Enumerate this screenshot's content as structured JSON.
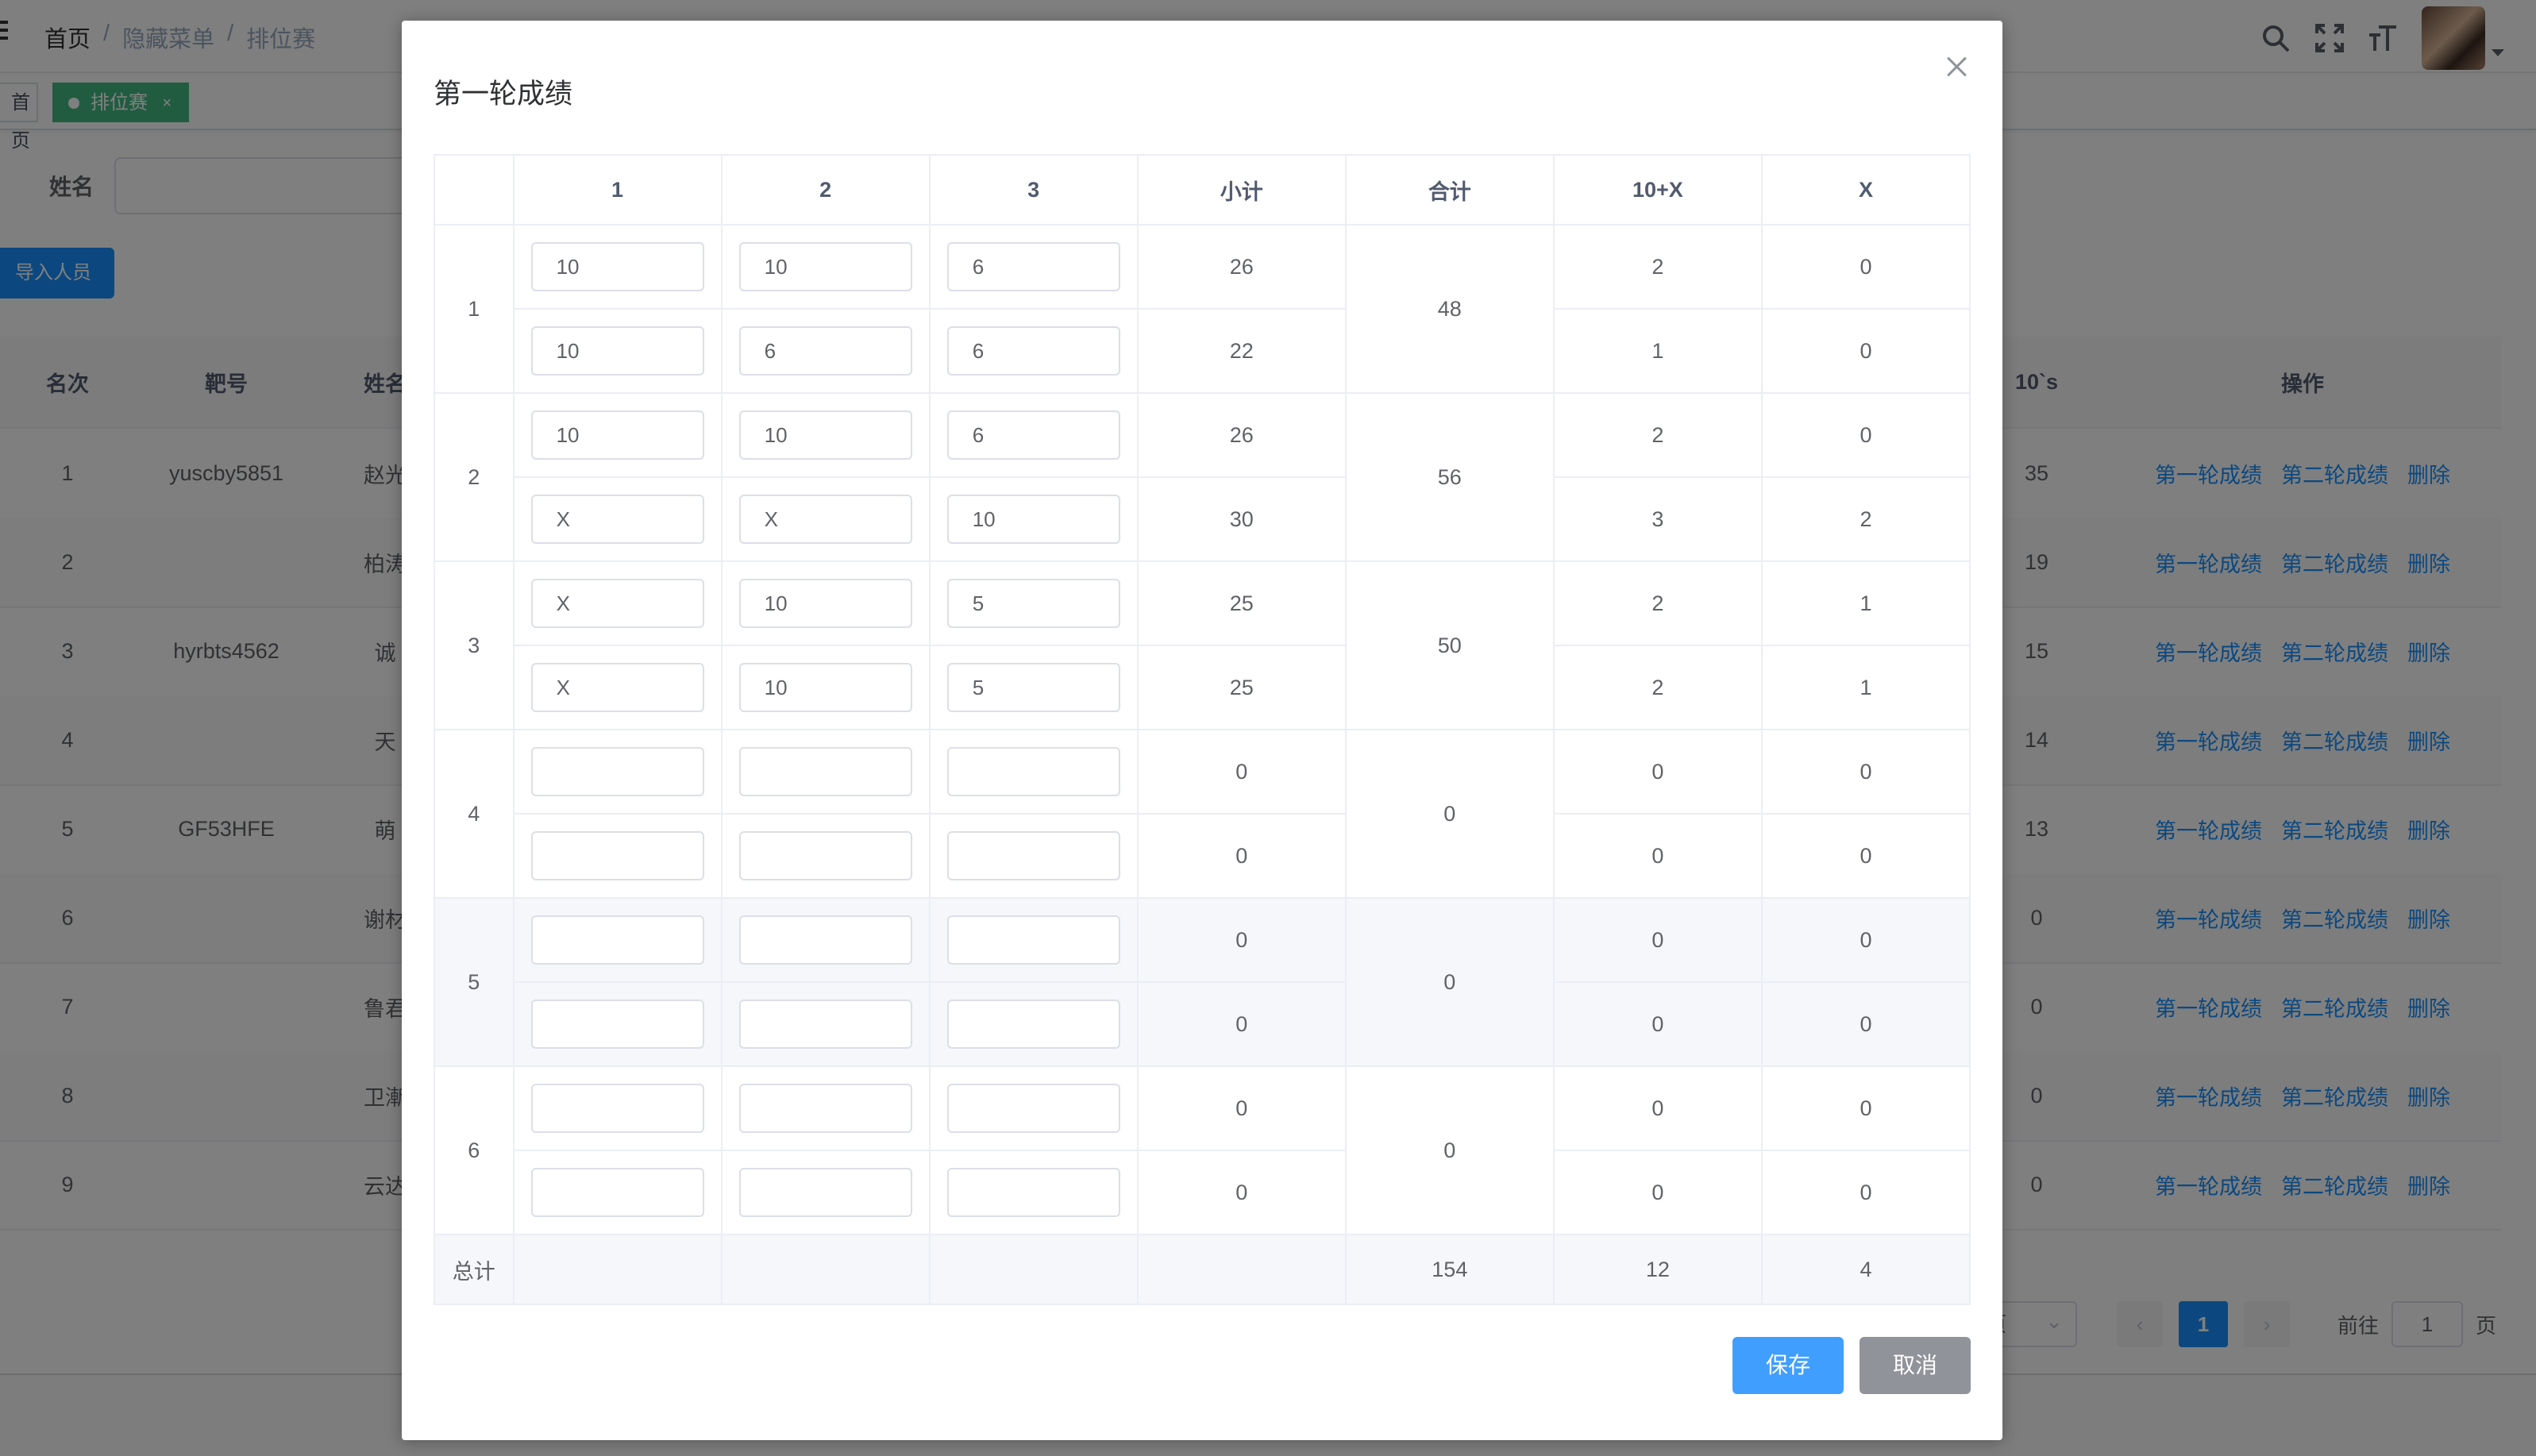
{
  "breadcrumb": [
    "首页",
    "隐藏菜单",
    "排位赛"
  ],
  "breadcrumb_separator": "/",
  "tags": [
    {
      "label": "首页"
    },
    {
      "label": "排位赛",
      "close": "×"
    }
  ],
  "search": {
    "label": "姓名",
    "value": ""
  },
  "import_button": "导入人员",
  "bg_table": {
    "headers": {
      "rank": "名次",
      "target": "靶号",
      "name": "姓名",
      "tens": "10`s",
      "ops": "操作"
    },
    "ops_links": [
      "第一轮成绩",
      "第二轮成绩",
      "删除"
    ],
    "rows": [
      {
        "rank": "1",
        "target": "yuscby5851",
        "name": "赵光",
        "tens": "35"
      },
      {
        "rank": "2",
        "target": "",
        "name": "柏涛",
        "tens": "19"
      },
      {
        "rank": "3",
        "target": "hyrbts4562",
        "name": "诚",
        "tens": "15"
      },
      {
        "rank": "4",
        "target": "",
        "name": "天",
        "tens": "14"
      },
      {
        "rank": "5",
        "target": "GF53HFE",
        "name": "萌",
        "tens": "13"
      },
      {
        "rank": "6",
        "target": "",
        "name": "谢材",
        "tens": "0"
      },
      {
        "rank": "7",
        "target": "",
        "name": "鲁君",
        "tens": "0"
      },
      {
        "rank": "8",
        "target": "",
        "name": "卫漸",
        "tens": "0"
      },
      {
        "rank": "9",
        "target": "",
        "name": "云达",
        "tens": "0"
      }
    ]
  },
  "pagination": {
    "size_text": "条/页",
    "prev": "‹",
    "next": "›",
    "current": "1",
    "goto_label": "前往",
    "goto_value": "1",
    "page_suffix": "页"
  },
  "dialog": {
    "title": "第一轮成绩",
    "headers": [
      "",
      "1",
      "2",
      "3",
      "小计",
      "合计",
      "10+X",
      "X"
    ],
    "groups": [
      {
        "label": "1",
        "total": "48",
        "rows": [
          {
            "a1": "10",
            "a2": "10",
            "a3": "6",
            "subtotal": "26",
            "tx": "2",
            "x": "0"
          },
          {
            "a1": "10",
            "a2": "6",
            "a3": "6",
            "subtotal": "22",
            "tx": "1",
            "x": "0"
          }
        ]
      },
      {
        "label": "2",
        "total": "56",
        "rows": [
          {
            "a1": "10",
            "a2": "10",
            "a3": "6",
            "subtotal": "26",
            "tx": "2",
            "x": "0"
          },
          {
            "a1": "X",
            "a2": "X",
            "a3": "10",
            "subtotal": "30",
            "tx": "3",
            "x": "2"
          }
        ]
      },
      {
        "label": "3",
        "total": "50",
        "rows": [
          {
            "a1": "X",
            "a2": "10",
            "a3": "5",
            "subtotal": "25",
            "tx": "2",
            "x": "1"
          },
          {
            "a1": "X",
            "a2": "10",
            "a3": "5",
            "subtotal": "25",
            "tx": "2",
            "x": "1"
          }
        ]
      },
      {
        "label": "4",
        "total": "0",
        "rows": [
          {
            "a1": "",
            "a2": "",
            "a3": "",
            "subtotal": "0",
            "tx": "0",
            "x": "0"
          },
          {
            "a1": "",
            "a2": "",
            "a3": "",
            "subtotal": "0",
            "tx": "0",
            "x": "0"
          }
        ]
      },
      {
        "label": "5",
        "total": "0",
        "rows": [
          {
            "a1": "",
            "a2": "",
            "a3": "",
            "subtotal": "0",
            "tx": "0",
            "x": "0"
          },
          {
            "a1": "",
            "a2": "",
            "a3": "",
            "subtotal": "0",
            "tx": "0",
            "x": "0"
          }
        ]
      },
      {
        "label": "6",
        "total": "0",
        "rows": [
          {
            "a1": "",
            "a2": "",
            "a3": "",
            "subtotal": "0",
            "tx": "0",
            "x": "0"
          },
          {
            "a1": "",
            "a2": "",
            "a3": "",
            "subtotal": "0",
            "tx": "0",
            "x": "0"
          }
        ]
      }
    ],
    "total_row": {
      "label": "总计",
      "total": "154",
      "tx": "12",
      "x": "4"
    },
    "save_label": "保存",
    "cancel_label": "取消"
  },
  "colors": {
    "primary": "#409eff",
    "link": "#1890ff",
    "tag_active": "#42b983",
    "mask": "rgba(0,0,0,0.5)"
  },
  "icons": [
    "hamburger-icon",
    "search-icon",
    "fullscreen-icon",
    "font-size-icon",
    "close-icon"
  ]
}
